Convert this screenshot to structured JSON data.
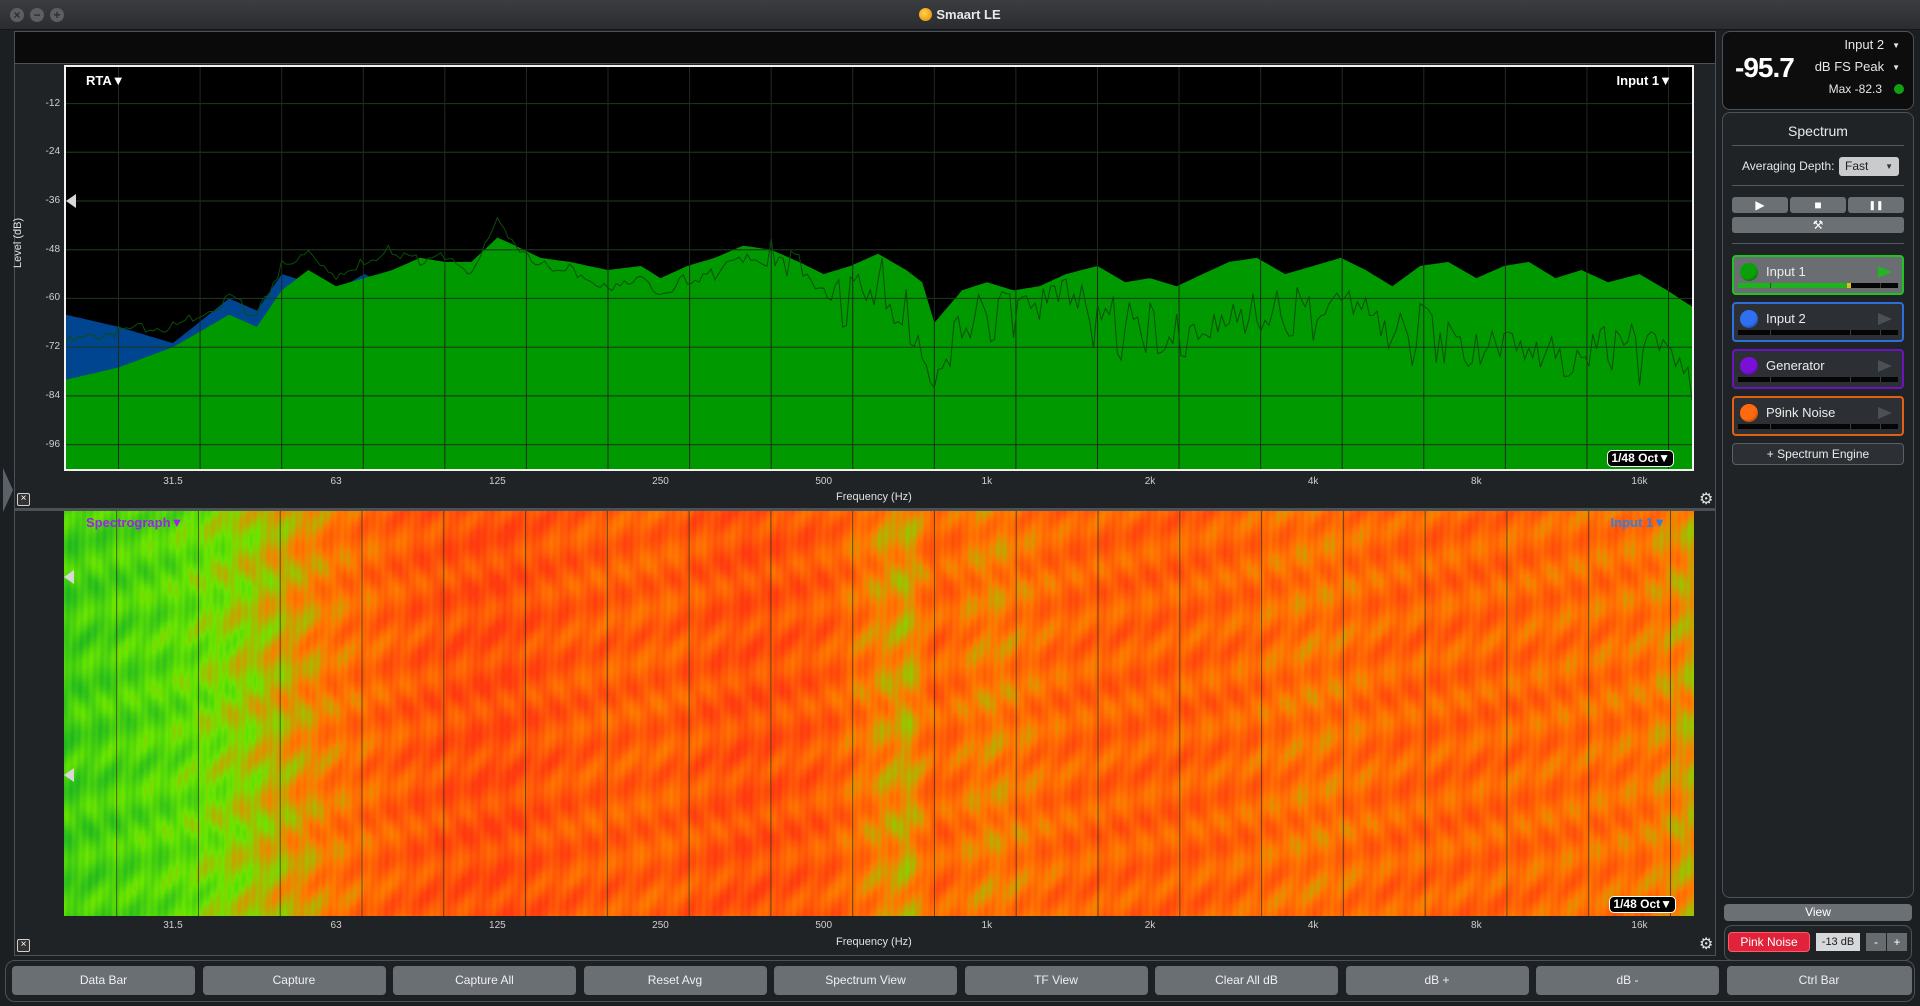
{
  "window": {
    "title": "Smaart LE",
    "controls": [
      "close",
      "minimize",
      "zoom"
    ]
  },
  "rta": {
    "plot_label": "RTA▼",
    "input_label": "Input 1▼",
    "resolution_label": "1/48 Oct▼",
    "y_axis_title": "Level (dB)",
    "x_axis_title": "Frequency (Hz)"
  },
  "spectrograph": {
    "plot_label": "Spectrograph▼",
    "input_label": "Input 1▼",
    "resolution_label": "1/48 Oct▼",
    "x_axis_title": "Frequency (Hz)",
    "label_color": "#a020f0",
    "input_color": "#2f7fe6"
  },
  "chart_data": [
    {
      "type": "area",
      "title": "RTA",
      "xlabel": "Frequency (Hz)",
      "ylabel": "Level (dB)",
      "x_scale": "log",
      "xlim": [
        20,
        20000
      ],
      "ylim": [
        -102,
        -3
      ],
      "grid": true,
      "x_ticks": [
        31.5,
        63,
        125,
        250,
        500,
        1000,
        2000,
        4000,
        8000,
        16000
      ],
      "x_tick_labels": [
        "31.5",
        "63",
        "125",
        "250",
        "500",
        "1k",
        "2k",
        "4k",
        "8k",
        "16k"
      ],
      "y_ticks": [
        -12,
        -24,
        -36,
        -48,
        -60,
        -72,
        -84,
        -96
      ],
      "y_tick_labels": [
        "-12",
        "-24",
        "-36",
        "-48",
        "-60",
        "-72",
        "-84",
        "-96"
      ],
      "series": [
        {
          "name": "Input 1",
          "color": "#009900",
          "style": "filled",
          "x": [
            20,
            25,
            31.5,
            40,
            45,
            50,
            56,
            63,
            71,
            80,
            90,
            100,
            112,
            125,
            135,
            150,
            170,
            200,
            230,
            250,
            280,
            315,
            355,
            400,
            450,
            500,
            560,
            630,
            710,
            760,
            800,
            900,
            1000,
            1120,
            1250,
            1400,
            1600,
            1800,
            2000,
            2240,
            2500,
            2800,
            3150,
            3550,
            4000,
            4500,
            5000,
            5600,
            6300,
            7100,
            8000,
            9000,
            10000,
            11200,
            12500,
            14000,
            16000,
            18000,
            20000
          ],
          "values": [
            -80,
            -77,
            -72,
            -64,
            -67,
            -58,
            -53,
            -57,
            -55,
            -53,
            -50,
            -51,
            -51,
            -45,
            -47,
            -50,
            -51,
            -53,
            -52,
            -55,
            -52,
            -50,
            -47,
            -48,
            -51,
            -54,
            -52,
            -49,
            -53,
            -56,
            -66,
            -58,
            -56,
            -58,
            -57,
            -54,
            -52,
            -56,
            -55,
            -57,
            -54,
            -51,
            -50,
            -54,
            -52,
            -50,
            -53,
            -57,
            -52,
            -51,
            -55,
            -52,
            -51,
            -55,
            -53,
            -56,
            -54,
            -58,
            -62
          ]
        },
        {
          "name": "Input 2",
          "color": "#00458f",
          "style": "filled",
          "x": [
            20,
            25,
            31.5,
            40,
            45,
            50,
            56,
            63,
            71,
            80
          ],
          "values": [
            -64,
            -67,
            -71,
            -60,
            -63,
            -54,
            -56,
            -58,
            -54,
            -57
          ]
        },
        {
          "name": "Input 1 (peak trace)",
          "color": "#0b4d0b",
          "style": "line",
          "x": [
            20,
            25,
            31.5,
            40,
            45,
            50,
            56,
            63,
            71,
            80,
            90,
            100,
            112,
            125,
            135,
            150,
            170,
            200,
            230,
            250,
            280,
            315,
            355,
            400,
            450,
            500,
            560,
            630,
            710,
            760,
            800,
            900,
            1000,
            1120,
            1250,
            1400,
            1600,
            1800,
            2000,
            2240,
            2500,
            2800,
            3150,
            3550,
            4000,
            4500,
            5000,
            5600,
            6300,
            7100,
            8000,
            9000,
            10000,
            11200,
            12500,
            14000,
            16000,
            18000,
            20000
          ],
          "values": [
            -71,
            -68,
            -67,
            -60,
            -64,
            -52,
            -48,
            -54,
            -51,
            -48,
            -51,
            -50,
            -55,
            -41,
            -48,
            -52,
            -53,
            -57,
            -54,
            -59,
            -55,
            -54,
            -50,
            -53,
            -56,
            -62,
            -59,
            -56,
            -62,
            -67,
            -78,
            -64,
            -64,
            -62,
            -66,
            -62,
            -66,
            -68,
            -65,
            -68,
            -64,
            -61,
            -63,
            -66,
            -64,
            -66,
            -66,
            -72,
            -68,
            -68,
            -69,
            -67,
            -70,
            -72,
            -73,
            -75,
            -74,
            -78,
            -85
          ]
        }
      ]
    },
    {
      "type": "heatmap",
      "title": "Spectrograph",
      "xlabel": "Frequency (Hz)",
      "x_scale": "log",
      "xlim": [
        20,
        20000
      ],
      "x_ticks": [
        31.5,
        63,
        125,
        250,
        500,
        1000,
        2000,
        4000,
        8000,
        16000
      ],
      "x_tick_labels": [
        "31.5",
        "63",
        "125",
        "250",
        "500",
        "1k",
        "2k",
        "4k",
        "8k",
        "16k"
      ],
      "colormap": [
        "#1fb81f",
        "#6be600",
        "#ff7a00",
        "#ff3a10"
      ],
      "band_levels": {
        "x": [
          20,
          31.5,
          45,
          63,
          90,
          125,
          180,
          250,
          355,
          500,
          710,
          800,
          1000,
          1400,
          2000,
          2800,
          4000,
          5600,
          8000,
          11200,
          16000,
          20000
        ],
        "intensity": [
          0.15,
          0.25,
          0.45,
          0.7,
          0.85,
          0.9,
          0.82,
          0.8,
          0.88,
          0.83,
          0.55,
          0.8,
          0.65,
          0.78,
          0.8,
          0.78,
          0.7,
          0.78,
          0.78,
          0.75,
          0.72,
          0.55
        ]
      }
    }
  ],
  "meter": {
    "value": "-95.7",
    "source": "Input 2",
    "units": "dB FS Peak",
    "max_label": "Max -82.3",
    "status_color": "#12a012"
  },
  "spectrum_panel": {
    "title": "Spectrum",
    "averaging_label": "Averaging Depth:",
    "averaging_value": "Fast",
    "transport": {
      "play_icon": "▶",
      "stop_icon": "■",
      "pause_icon": "❚❚",
      "tools_icon": "⚒"
    },
    "engines": [
      {
        "name": "Input 1",
        "color": "#0aa00a",
        "border": "#1fc41f",
        "active": true,
        "level": 0.68,
        "play_color": "#22b422"
      },
      {
        "name": "Input 2",
        "color": "#2f6ff2",
        "border": "#2f6fdc",
        "active": false,
        "level": 0,
        "play_color": "#4b5055"
      },
      {
        "name": "Generator",
        "color": "#7a10d8",
        "border": "#6a14c0",
        "active": false,
        "level": 0,
        "play_color": "#4b5055"
      },
      {
        "name": "P9ink Noise",
        "color": "#ff6a10",
        "border": "#e06015",
        "active": false,
        "level": 0,
        "play_color": "#4b5055"
      }
    ],
    "add_engine_label": "+ Spectrum Engine"
  },
  "view_button": "View",
  "generator": {
    "button_label": "Pink Noise",
    "level": "-13 dB",
    "minus": "-",
    "plus": "+"
  },
  "bottom_bar": {
    "buttons": [
      "Data Bar",
      "Capture",
      "Capture All",
      "Reset Avg",
      "Spectrum View",
      "TF View",
      "Clear All dB",
      "dB +",
      "dB -",
      "Ctrl Bar"
    ]
  }
}
